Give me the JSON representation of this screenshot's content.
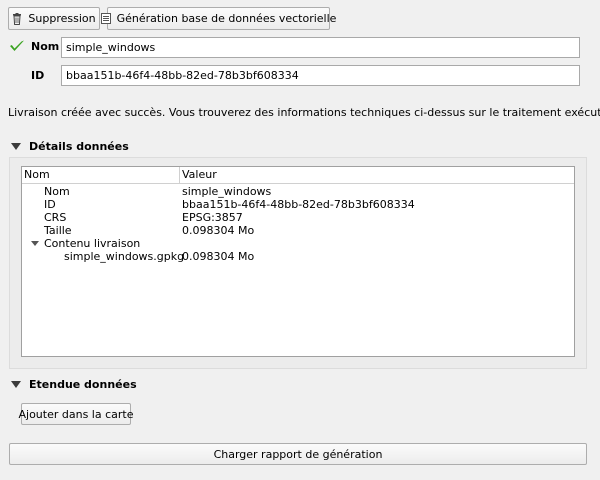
{
  "toolbar": {
    "delete_label": "Suppression",
    "generate_label": "Génération base de données vectorielle"
  },
  "form": {
    "name_label": "Nom",
    "name_value": "simple_windows",
    "id_label": "ID",
    "id_value": "bbaa151b-46f4-48bb-82ed-78b3bf608334"
  },
  "status_message": "Livraison créée avec succès. Vous trouverez des informations techniques ci-dessus sur le traitement exécuté.",
  "details": {
    "title": "Détails données",
    "columns": [
      "Nom",
      "Valeur"
    ],
    "rows": [
      {
        "key": "Nom",
        "value": "simple_windows"
      },
      {
        "key": "ID",
        "value": "bbaa151b-46f4-48bb-82ed-78b3bf608334"
      },
      {
        "key": "CRS",
        "value": "EPSG:3857"
      },
      {
        "key": "Taille",
        "value": "0.098304 Mo"
      },
      {
        "key": "Contenu livraison",
        "value": ""
      },
      {
        "key": "simple_windows.gpkg",
        "value": "0.098304 Mo"
      }
    ]
  },
  "extent": {
    "title": "Etendue données",
    "add_to_map_label": "Ajouter dans la carte"
  },
  "load_report_label": "Charger rapport de génération",
  "colors": {
    "check_green": "#3aa320",
    "background": "#f0f0f0"
  },
  "icons": {
    "delete": "trash-icon",
    "generate": "database-icon",
    "valid": "checkmark-icon"
  }
}
